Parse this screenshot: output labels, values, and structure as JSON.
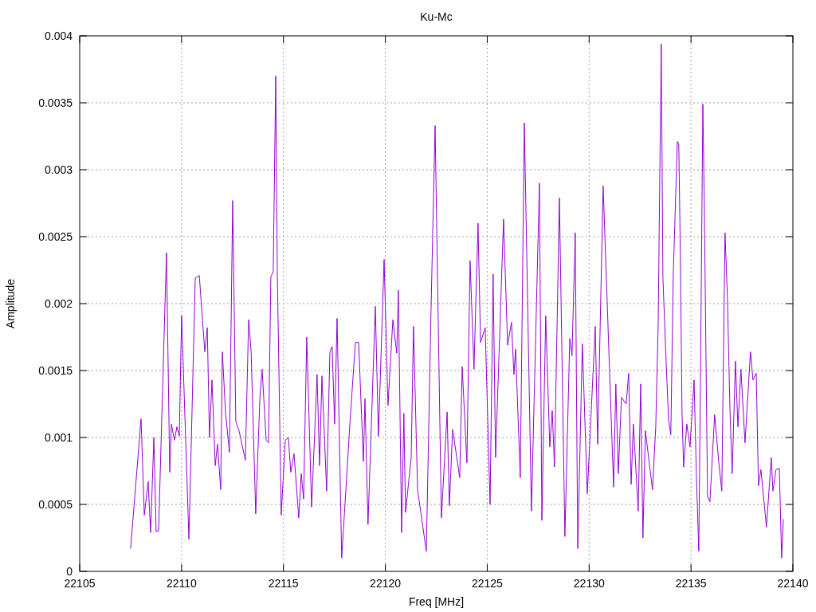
{
  "chart_data": {
    "type": "line",
    "title": "Ku-Mc",
    "xlabel": "Freq [MHz]",
    "ylabel": "Amplitude",
    "x": [
      22107.5,
      22108.01,
      22108.17,
      22108.36,
      22108.48,
      22108.64,
      22108.75,
      22108.87,
      22109.26,
      22109.42,
      22109.5,
      22109.65,
      22109.77,
      22109.89,
      22110.0,
      22110.36,
      22110.67,
      22110.87,
      22111.14,
      22111.26,
      22111.37,
      22111.49,
      22111.65,
      22111.76,
      22111.92,
      22112.0,
      22112.16,
      22112.35,
      22112.51,
      22112.66,
      22112.82,
      22113.13,
      22113.29,
      22113.41,
      22113.64,
      22113.84,
      22113.95,
      22114.15,
      22114.27,
      22114.38,
      22114.5,
      22114.62,
      22114.7,
      22114.89,
      22115.09,
      22115.24,
      22115.36,
      22115.52,
      22115.75,
      22115.87,
      22115.99,
      22116.14,
      22116.38,
      22116.65,
      22116.77,
      22116.89,
      22117.12,
      22117.28,
      22117.39,
      22117.51,
      22117.63,
      22117.86,
      22118.29,
      22118.53,
      22118.69,
      22118.92,
      22119.0,
      22119.15,
      22119.51,
      22119.66,
      22119.94,
      22120.13,
      22120.37,
      22120.56,
      22120.64,
      22120.8,
      22120.91,
      22120.99,
      22121.27,
      22121.38,
      22121.58,
      22122.01,
      22122.24,
      22122.44,
      22122.75,
      22123.03,
      22123.14,
      22123.3,
      22123.65,
      22123.77,
      22124.0,
      22124.16,
      22124.35,
      22124.55,
      22124.67,
      22124.9,
      22125.14,
      22125.29,
      22125.41,
      22125.8,
      22126.0,
      22126.19,
      22126.31,
      22126.39,
      22126.62,
      22126.82,
      22127.17,
      22127.56,
      22127.68,
      22127.87,
      22128.07,
      22128.19,
      22128.3,
      22128.54,
      22128.81,
      22129.05,
      22129.16,
      22129.32,
      22129.44,
      22129.67,
      22129.91,
      22130.3,
      22130.42,
      22130.69,
      22131.2,
      22131.31,
      22131.43,
      22131.59,
      22131.82,
      22131.94,
      22132.06,
      22132.17,
      22132.41,
      22132.53,
      22132.64,
      22132.76,
      22133.11,
      22133.27,
      22133.39,
      22133.47,
      22133.54,
      22133.62,
      22133.78,
      22133.9,
      22134.01,
      22134.13,
      22134.33,
      22134.4,
      22134.48,
      22134.56,
      22134.64,
      22134.79,
      22134.95,
      22135.15,
      22135.26,
      22135.38,
      22135.46,
      22135.58,
      22135.65,
      22135.81,
      22135.93,
      22136.16,
      22136.36,
      22136.51,
      22136.67,
      22136.79,
      22136.91,
      22137.02,
      22137.18,
      22137.3,
      22137.45,
      22137.65,
      22137.92,
      22138.04,
      22138.2,
      22138.31,
      22138.43,
      22138.7,
      22138.94,
      22139.02,
      22139.17,
      22139.33,
      22139.45,
      22139.53
    ],
    "series": [
      {
        "color": "#9400d3",
        "values": [
          0.00017,
          0.00114,
          0.00042,
          0.00067,
          0.00029,
          0.001,
          0.0003,
          0.0003,
          0.00238,
          0.00074,
          0.0011,
          0.00098,
          0.00108,
          0.00101,
          0.00191,
          0.00024,
          0.00219,
          0.00221,
          0.00164,
          0.00182,
          0.001,
          0.00143,
          0.00079,
          0.00095,
          0.00061,
          0.00164,
          0.00118,
          0.00089,
          0.00277,
          0.00112,
          0.00105,
          0.00083,
          0.00188,
          0.00165,
          0.00043,
          0.00129,
          0.00151,
          0.00098,
          0.00096,
          0.0022,
          0.00224,
          0.0037,
          0.00224,
          0.00042,
          0.00098,
          0.001,
          0.00074,
          0.00088,
          0.0004,
          0.00073,
          0.00054,
          0.00175,
          0.00048,
          0.00147,
          0.00079,
          0.00146,
          0.0006,
          0.00164,
          0.00168,
          0.0011,
          0.00189,
          0.0001,
          0.00117,
          0.00171,
          0.00171,
          0.00082,
          0.00129,
          0.00035,
          0.00198,
          0.00101,
          0.00233,
          0.00124,
          0.00188,
          0.00163,
          0.0021,
          0.00029,
          0.00118,
          0.00044,
          0.00085,
          0.00183,
          0.00061,
          0.00015,
          0.00195,
          0.00333,
          0.0004,
          0.00119,
          0.00049,
          0.00106,
          0.0007,
          0.00153,
          0.00081,
          0.00232,
          0.00151,
          0.0026,
          0.00171,
          0.00182,
          0.0005,
          0.00222,
          0.00085,
          0.00263,
          0.00169,
          0.00186,
          0.00147,
          0.00166,
          0.0007,
          0.00335,
          0.00045,
          0.0029,
          0.00038,
          0.00191,
          0.00093,
          0.0012,
          0.00078,
          0.00279,
          0.00026,
          0.00174,
          0.00161,
          0.00253,
          0.00017,
          0.0017,
          0.00058,
          0.00183,
          0.00095,
          0.00288,
          0.00063,
          0.0014,
          0.00073,
          0.0013,
          0.00125,
          0.00148,
          0.00065,
          0.0011,
          0.00045,
          0.0014,
          0.00025,
          0.00105,
          0.00061,
          0.00108,
          0.00186,
          0.00297,
          0.00394,
          0.00219,
          0.00157,
          0.00113,
          0.00102,
          0.00222,
          0.00321,
          0.00319,
          0.00235,
          0.00118,
          0.00078,
          0.0011,
          0.00093,
          0.00143,
          0.00074,
          0.00015,
          0.00136,
          0.00349,
          0.00276,
          0.00056,
          0.00052,
          0.00117,
          0.00082,
          0.0006,
          0.00253,
          0.00204,
          0.00121,
          0.00073,
          0.00157,
          0.00108,
          0.00151,
          0.00096,
          0.00164,
          0.00143,
          0.00148,
          0.00064,
          0.00076,
          0.00033,
          0.00085,
          0.0006,
          0.00076,
          0.00077,
          0.0001,
          0.00039
        ]
      }
    ],
    "xlim": [
      22105,
      22140
    ],
    "ylim": [
      0,
      0.004
    ],
    "xticks": [
      22105,
      22110,
      22115,
      22120,
      22125,
      22130,
      22135,
      22140
    ],
    "yticks": [
      0,
      0.0005,
      0.001,
      0.0015,
      0.002,
      0.0025,
      0.003,
      0.0035,
      0.004
    ],
    "grid": true
  }
}
